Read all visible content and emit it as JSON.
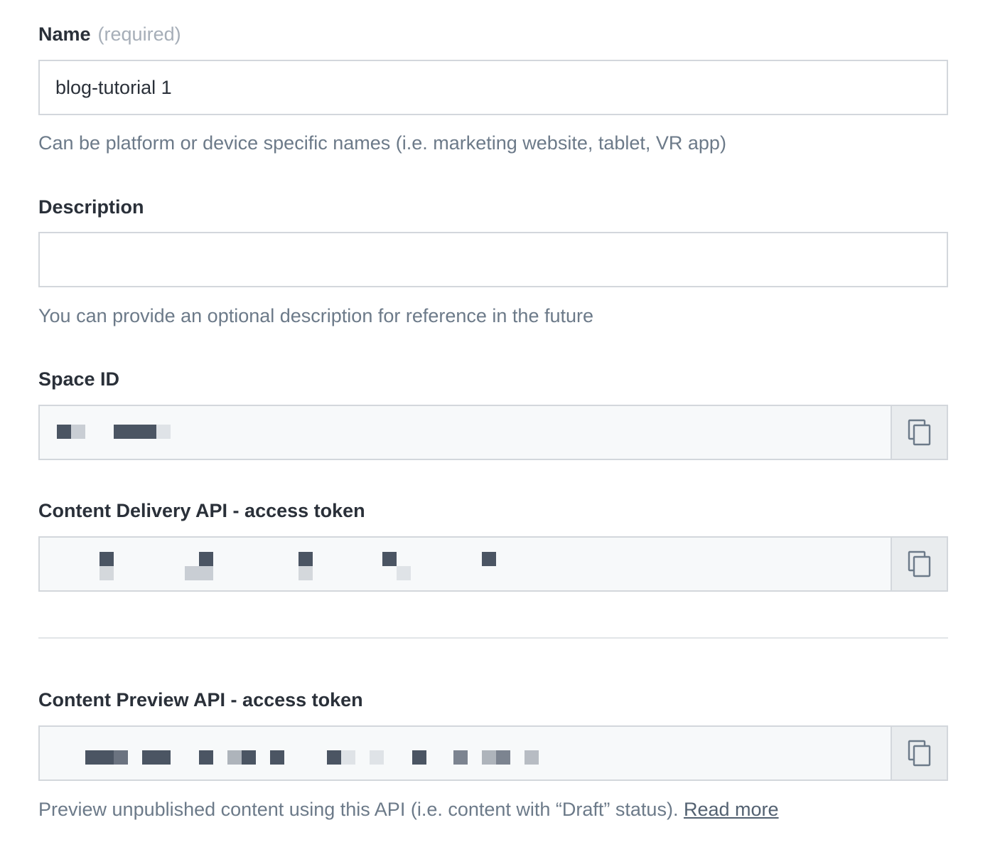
{
  "name_field": {
    "label": "Name",
    "required_text": "(required)",
    "value": "blog-tutorial 1",
    "help": "Can be platform or device specific names (i.e. marketing website, tablet, VR app)"
  },
  "description_field": {
    "label": "Description",
    "value": "",
    "help": "You can provide an optional description for reference in the future"
  },
  "space_id": {
    "label": "Space ID",
    "copy_icon": "copy-icon"
  },
  "delivery_token": {
    "label": "Content Delivery API - access token",
    "copy_icon": "copy-icon"
  },
  "preview_token": {
    "label": "Content Preview API - access token",
    "copy_icon": "copy-icon",
    "help": "Preview unpublished content using this API (i.e. content with “Draft” status).",
    "read_more": "Read more"
  }
}
